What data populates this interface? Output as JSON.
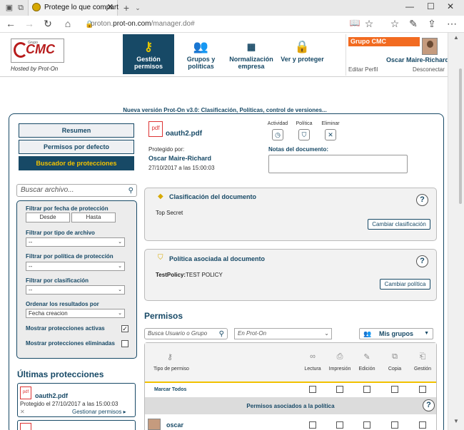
{
  "browser": {
    "tab_title": "Protege lo que compart",
    "url_prefix": "proton.",
    "url_domain": "prot-on.com",
    "url_path": "/manager.do#"
  },
  "header": {
    "logo_group": "Grupo",
    "logo_text": "CMC",
    "hosted_by": "Hosted by Prot-On",
    "nav": [
      {
        "label": "Gestión permisos",
        "icon": "key-icon",
        "active": true
      },
      {
        "label": "Grupos y políticas",
        "icon": "users-icon",
        "active": false
      },
      {
        "label": "Normalización empresa",
        "icon": "org-chart-icon",
        "active": false
      },
      {
        "label": "Ver y proteger",
        "icon": "lock-icon",
        "active": false
      }
    ],
    "group_badge": "Grupo CMC",
    "user_name": "Oscar Maire-Richard",
    "edit_profile": "Editar Perfil",
    "logout": "Desconectar"
  },
  "banner": "Nueva versión Prot-On v3.0: Clasificación, Políticas, control de versiones...",
  "sidebar": {
    "buttons": [
      "Resumen",
      "Permisos por defecto",
      "Buscador de protecciones"
    ],
    "search_placeholder": "Buscar archivo...",
    "filters": {
      "date_label": "Filtrar por fecha de protección",
      "from": "Desde",
      "to": "Hasta",
      "filetype_label": "Filtrar por tipo de archivo",
      "filetype_value": "--",
      "policy_label": "Filtrar por política de protección",
      "policy_value": "--",
      "class_label": "Filtrar por clasificación",
      "class_value": "--",
      "order_label": "Ordenar los resultados por",
      "order_value": "Fecha creacion",
      "show_active": "Mostrar protecciones activas",
      "show_active_checked": true,
      "show_deleted": "Mostrar protecciones eliminadas",
      "show_deleted_checked": false
    },
    "recent_title": "Últimas protecciones",
    "recent": [
      {
        "file": "oauth2.pdf",
        "date": "Protegido el 27/10/2017 a las 15:00:03",
        "manage": "Gestionar permisos"
      }
    ]
  },
  "document": {
    "file": "oauth2.pdf",
    "pdf_badge": "pdf",
    "actions": [
      "Actividad",
      "Política",
      "Eliminar"
    ],
    "protected_by_label": "Protegido por:",
    "protected_by": "Oscar Maire-Richard",
    "protected_date": "27/10/2017 a las 15:00:03",
    "notes_label": "Notas del documento:",
    "classification": {
      "title": "Clasificación del documento",
      "value": "Top Secret",
      "button": "Cambiar clasificación"
    },
    "policy": {
      "title": "Política asociada al documento",
      "label": "TestPolicy:",
      "value": "TEST POLICY",
      "button": "Cambiar política"
    }
  },
  "permissions": {
    "title": "Permisos",
    "user_search_placeholder": "Busca Usuario o Grupo",
    "scope_value": "En Prot-On",
    "groups_button": "Mis grupos",
    "type_header": "Tipo de permiso",
    "columns": [
      {
        "label": "Lectura",
        "icon": "glasses-icon"
      },
      {
        "label": "Impresión",
        "icon": "printer-icon"
      },
      {
        "label": "Edición",
        "icon": "pencil-icon"
      },
      {
        "label": "Copia",
        "icon": "copy-icon"
      },
      {
        "label": "Gestión",
        "icon": "manage-icon"
      }
    ],
    "mark_all": "Marcar Todos",
    "policy_band": "Permisos asociados a la política",
    "user_row": "oscar",
    "help": "?"
  }
}
